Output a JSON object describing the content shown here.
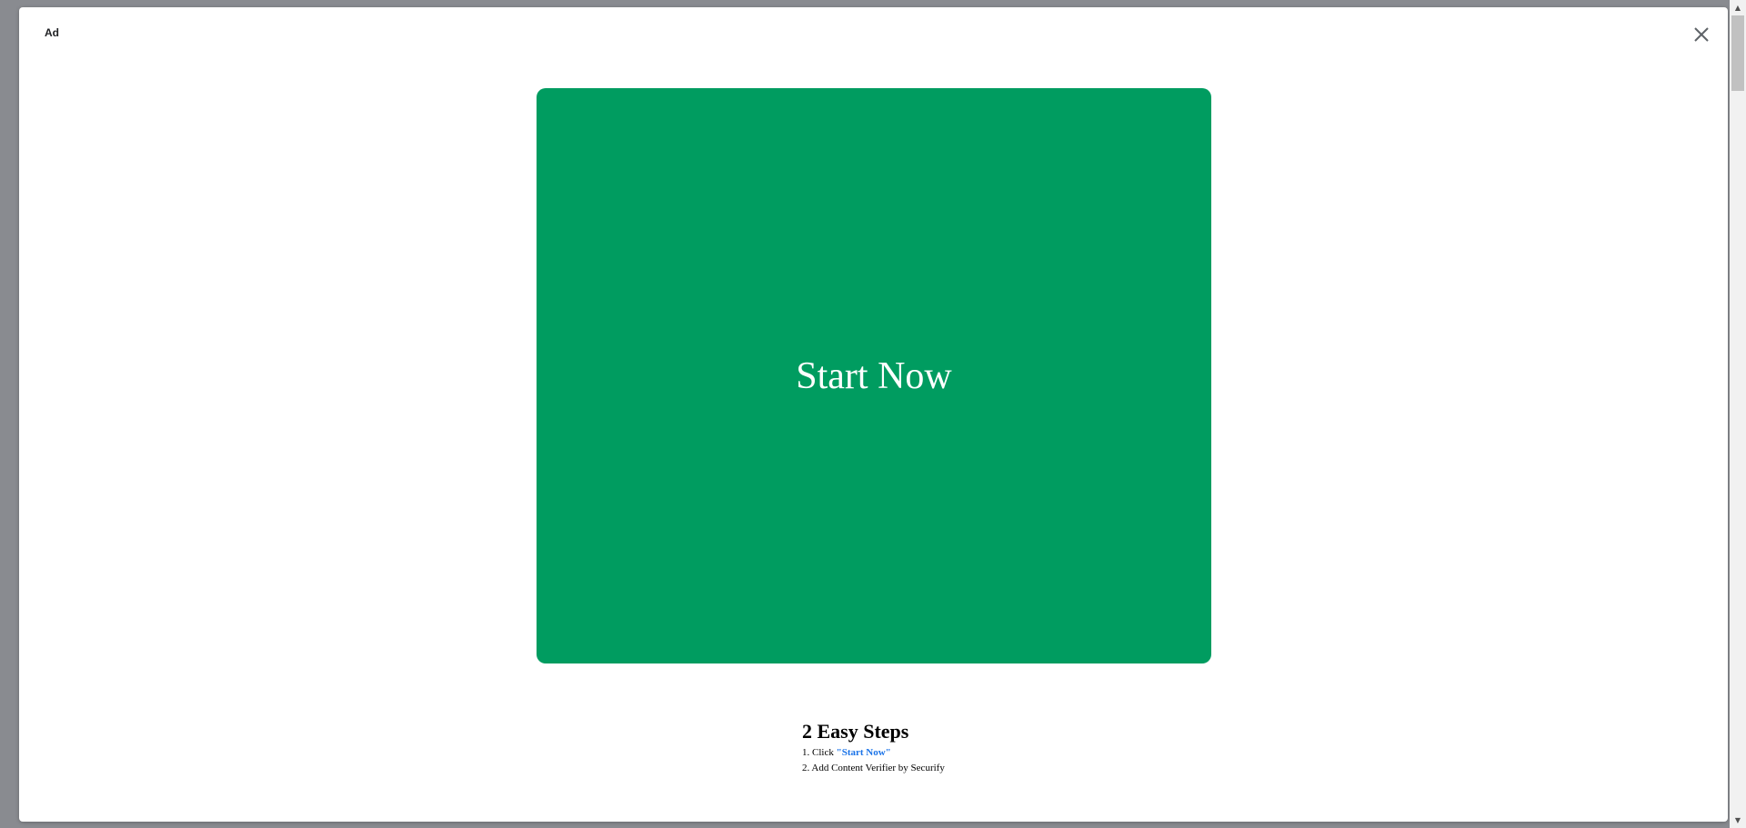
{
  "dialog": {
    "ad_label": "Ad",
    "close_icon": "close-icon"
  },
  "cta": {
    "label": "Start Now",
    "background_color": "#009c60",
    "text_color": "#ffffff"
  },
  "steps": {
    "title": "2 Easy Steps",
    "step1_prefix": "1. Click ",
    "step1_link": "\"Start Now\"",
    "step2": "2. Add Content Verifier by Securify",
    "link_color": "#1a73e8"
  },
  "scrollbar": {
    "up_arrow_icon": "up-arrow-icon",
    "down_arrow_icon": "down-arrow-icon"
  }
}
